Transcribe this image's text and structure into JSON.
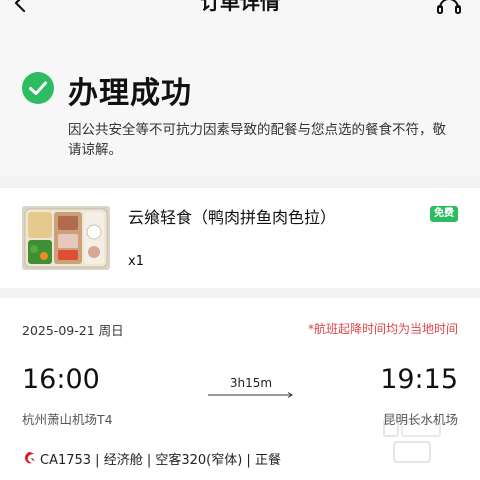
{
  "nav": {
    "title": "订单详情"
  },
  "status": {
    "title": "办理成功",
    "description": "因公共安全等不可抗力因素导致的配餐与您点选的餐食不符，敬请谅解。"
  },
  "meal": {
    "name": "云飨轻食（鸭肉拼鱼肉色拉）",
    "quantity": "x1",
    "badge": "免费"
  },
  "flight": {
    "date": "2025-09-21 周日",
    "time_note": "*航班起降时间均为当地时间",
    "departure_time": "16:00",
    "arrival_time": "19:15",
    "duration": "3h15m",
    "departure_airport": "杭州萧山机场T4",
    "arrival_airport": "昆明长水机场",
    "info": "CA1753 | 经济舱 | 空客320(窄体) | 正餐"
  },
  "colors": {
    "success_green": "#2ebc62",
    "note_red": "#e0454b",
    "airline_red": "#d71920"
  }
}
